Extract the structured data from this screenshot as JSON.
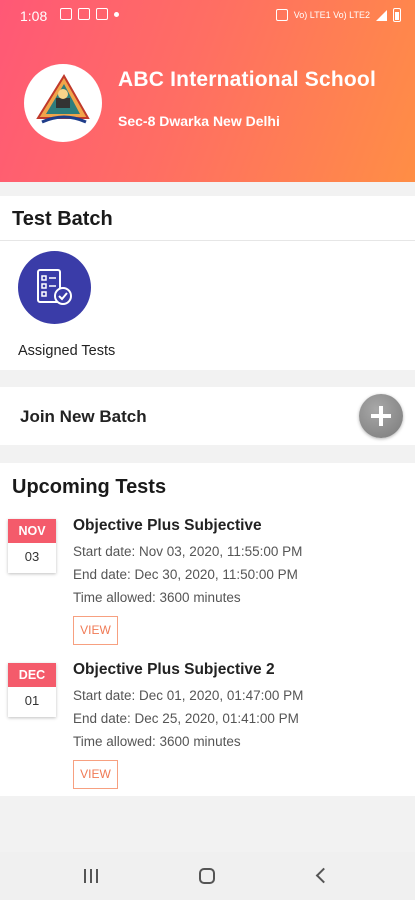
{
  "status_bar": {
    "time": "1:08",
    "network_label": "Vo) LTE1 Vo) LTE2"
  },
  "header": {
    "school_name": "ABC International School",
    "school_address": "Sec-8 Dwarka New Delhi"
  },
  "test_batch": {
    "title": "Test Batch",
    "tiles": [
      {
        "label": "Assigned Tests",
        "icon": "checklist-icon"
      }
    ]
  },
  "join_batch": {
    "label": "Join New Batch",
    "icon": "plus-icon"
  },
  "upcoming": {
    "title": "Upcoming Tests",
    "tests": [
      {
        "month": "NOV",
        "day": "03",
        "title": "Objective Plus Subjective",
        "start": "Start date: Nov 03, 2020, 11:55:00 PM",
        "end": "End date: Dec 30, 2020, 11:50:00 PM",
        "time_allowed": "Time allowed: 3600 minutes",
        "action": "VIEW"
      },
      {
        "month": "DEC",
        "day": "01",
        "title": "Objective Plus Subjective 2",
        "start": "Start date: Dec 01, 2020, 01:47:00 PM",
        "end": "End date: Dec 25, 2020, 01:41:00 PM",
        "time_allowed": "Time allowed: 3600 minutes",
        "action": "VIEW"
      }
    ]
  },
  "colors": {
    "header_gradient_start": "#ff5876",
    "header_gradient_end": "#ff8e45",
    "tile_circle": "#3a3ca8",
    "date_month_bg": "#f45b6b",
    "view_button": "#f07a55"
  }
}
